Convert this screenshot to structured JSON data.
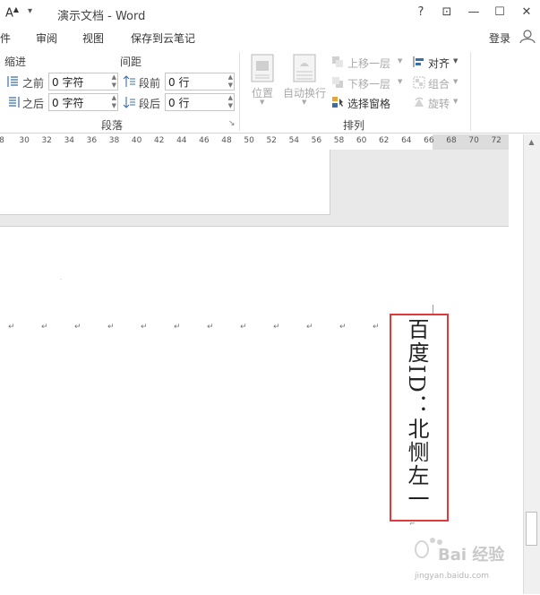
{
  "quick_access": {
    "font_glyph": "A",
    "customize_glyph": "▾"
  },
  "window": {
    "title": "演示文档 - Word",
    "help": "?",
    "restore_ribbon": "⊡",
    "minimize": "—",
    "maximize": "☐",
    "close": "✕"
  },
  "menu": {
    "tabs": [
      "件",
      "审阅",
      "视图",
      "保存到云笔记"
    ],
    "login": "登录"
  },
  "ribbon": {
    "paragraph": {
      "indent_label": "缩进",
      "spacing_label": "间距",
      "before_label": "之前",
      "after_label": "之后",
      "indent_before_value": "0 字符",
      "indent_after_value": "0 字符",
      "space_before_label": "段前",
      "space_after_label": "段后",
      "space_before_value": "0 行",
      "space_after_value": "0 行",
      "group_label": "段落",
      "launcher": "↘"
    },
    "arrange": {
      "position_label": "位置",
      "wrap_label": "自动换行",
      "bring_forward_label": "上移一层",
      "send_backward_label": "下移一层",
      "selection_pane_label": "选择窗格",
      "align_label": "对齐",
      "group_objects_label": "组合",
      "rotate_label": "旋转",
      "group_label": "排列"
    }
  },
  "ruler": {
    "ticks": [
      "8",
      "30",
      "32",
      "34",
      "36",
      "38",
      "40",
      "42",
      "44",
      "46",
      "48",
      "50",
      "52",
      "54",
      "56",
      "58",
      "60",
      "62",
      "64",
      "66",
      "68",
      "70",
      "72"
    ]
  },
  "document": {
    "paragraph_mark": "↵",
    "textbox_text": "百度ID：北恻左一"
  },
  "watermark": {
    "text": "Bai 经验",
    "url": "jingyan.baidu.com"
  },
  "scrollbar": {
    "up_arrow": "▲"
  },
  "colors": {
    "textbox_border": "#e03a3a",
    "doc_background": "#e9e9e9"
  }
}
